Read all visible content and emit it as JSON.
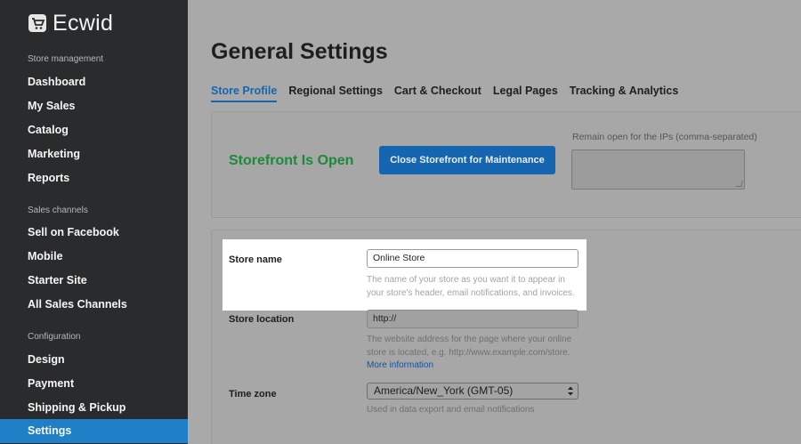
{
  "sidebar": {
    "brand": "Ecwid",
    "sections": [
      {
        "title": "Store management",
        "items": [
          "Dashboard",
          "My Sales",
          "Catalog",
          "Marketing",
          "Reports"
        ]
      },
      {
        "title": "Sales channels",
        "items": [
          "Sell on Facebook",
          "Mobile",
          "Starter Site",
          "All Sales Channels"
        ]
      },
      {
        "title": "Configuration",
        "items": [
          "Design",
          "Payment",
          "Shipping & Pickup",
          "Settings"
        ]
      }
    ],
    "active_item": "Settings"
  },
  "page": {
    "title": "General Settings",
    "tabs": [
      "Store Profile",
      "Regional Settings",
      "Cart & Checkout",
      "Legal Pages",
      "Tracking & Analytics"
    ],
    "active_tab": "Store Profile"
  },
  "storefront": {
    "status": "Storefront Is Open",
    "close_button": "Close Storefront for Maintenance",
    "ip_label": "Remain open for the IPs (comma-separated)",
    "ip_value": ""
  },
  "profile": {
    "store_name": {
      "label": "Store name",
      "value": "Online Store",
      "hint_line1": "The name of your store as you want it to appear in",
      "hint_line2": "your store's header, email notifications, and invoices."
    },
    "store_location": {
      "label": "Store location",
      "value": "http://",
      "hint_line1": "The website address for the page where your online",
      "hint_line2": "store is located, e.g. http://www.example.com/store.",
      "link": "More information"
    },
    "time_zone": {
      "label": "Time zone",
      "value": "America/New_York (GMT-05)",
      "hint": "Used in data export and email notifications"
    }
  },
  "colors": {
    "sidebar_bg": "#292b2d",
    "active_nav": "#1f7fc7",
    "accent_blue": "#1565b0",
    "open_green": "#1d8a3a"
  }
}
